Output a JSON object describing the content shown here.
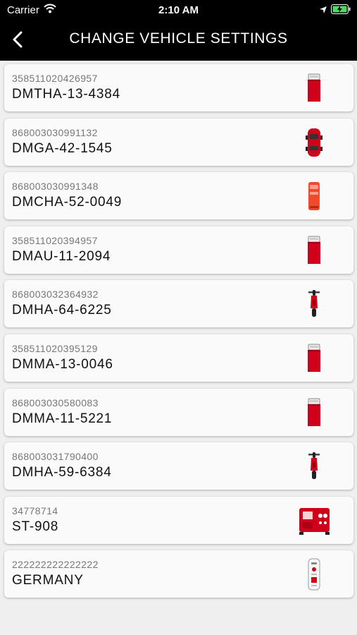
{
  "status": {
    "carrier": "Carrier",
    "time": "2:10 AM"
  },
  "header": {
    "title": "CHANGE VEHICLE SETTINGS"
  },
  "colors": {
    "accent": "#d0021b",
    "bar": "#000000"
  },
  "vehicles": [
    {
      "imei": "358511020426957",
      "name": "DMTHA-13-4384",
      "icon": "truck-icon"
    },
    {
      "imei": "868003030991132",
      "name": "DMGA-42-1545",
      "icon": "car-icon"
    },
    {
      "imei": "868003030991348",
      "name": "DMCHA-52-0049",
      "icon": "van-icon"
    },
    {
      "imei": "358511020394957",
      "name": "DMAU-11-2094",
      "icon": "truck-icon"
    },
    {
      "imei": "868003032364932",
      "name": "DMHA-64-6225",
      "icon": "motorcycle-icon"
    },
    {
      "imei": "358511020395129",
      "name": "DMMA-13-0046",
      "icon": "truck-icon"
    },
    {
      "imei": "868003030580083",
      "name": "DMMA-11-5221",
      "icon": "truck-icon"
    },
    {
      "imei": "868003031790400",
      "name": "DMHA-59-6384",
      "icon": "motorcycle-icon"
    },
    {
      "imei": "34778714",
      "name": "ST-908",
      "icon": "generator-icon"
    },
    {
      "imei": "222222222222222",
      "name": "GERMANY",
      "icon": "tracker-device-icon"
    }
  ]
}
